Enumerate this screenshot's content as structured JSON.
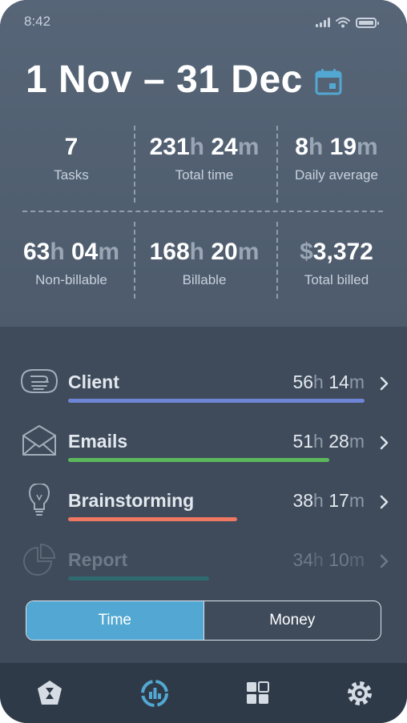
{
  "status_bar": {
    "time": "8:42"
  },
  "header": {
    "period": "1 Nov – 31 Dec"
  },
  "stats": [
    {
      "num1": "7",
      "unit1": "",
      "num2": "",
      "unit2": "",
      "label": "Tasks"
    },
    {
      "num1": "231",
      "unit1": "h",
      "num2": " 24",
      "unit2": "m",
      "label": "Total time"
    },
    {
      "num1": "8",
      "unit1": "h",
      "num2": " 19",
      "unit2": "m",
      "label": "Daily average"
    },
    {
      "num1": "63",
      "unit1": "h",
      "num2": " 04",
      "unit2": "m",
      "label": "Non-billable"
    },
    {
      "num1": "168",
      "unit1": "h",
      "num2": " 20",
      "unit2": "m",
      "label": "Billable"
    },
    {
      "prefix": "$",
      "num1": "3,372",
      "unit1": "",
      "num2": "",
      "unit2": "",
      "label": "Total billed"
    }
  ],
  "categories": [
    {
      "name": "Client",
      "hours": "56",
      "minutes": "14",
      "icon": "handshake-icon",
      "color": "#6f86d6",
      "share": 0.84
    },
    {
      "name": "Emails",
      "hours": "51",
      "minutes": "28",
      "icon": "envelope-icon",
      "color": "#5cb85c",
      "share": 0.74
    },
    {
      "name": "Brainstorming",
      "hours": "38",
      "minutes": "17",
      "icon": "lightbulb-icon",
      "color": "#f07762",
      "share": 0.48
    },
    {
      "name": "Report",
      "hours": "34",
      "minutes": "10",
      "icon": "pie-chart-icon",
      "color": "#2f6a70",
      "share": 0.4
    }
  ],
  "units": {
    "hours": "h",
    "minutes": "m"
  },
  "toggle": {
    "options": [
      "Time",
      "Money"
    ],
    "selected": "Time"
  },
  "tabbar": {
    "tabs": [
      "timer-icon",
      "stats-icon",
      "dashboard-icon",
      "settings-icon"
    ],
    "active": "stats-icon"
  },
  "colors": {
    "accent": "#52a8d2",
    "background": "#3f4b5b",
    "header": "#566577"
  }
}
